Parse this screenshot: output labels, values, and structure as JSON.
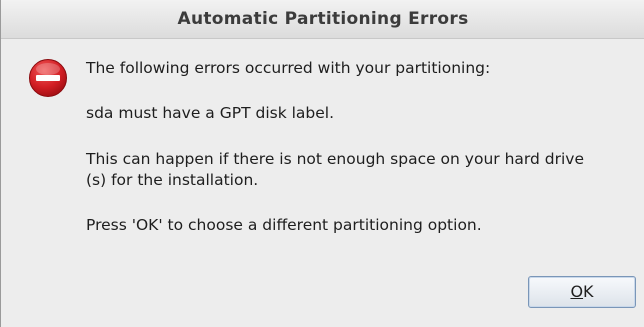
{
  "window": {
    "title": "Automatic Partitioning Errors"
  },
  "message": {
    "line1": "The following errors occurred with your partitioning:",
    "line2": "sda must have a GPT disk label.",
    "line3a": "This can happen if there is not enough space on your hard drive",
    "line3b": "(s) for the installation.",
    "line4": "Press 'OK' to choose a different partitioning option."
  },
  "icon": {
    "name": "error-icon",
    "color": "#c8161d"
  },
  "buttons": {
    "ok_mnemonic": "O",
    "ok_rest": "K"
  }
}
